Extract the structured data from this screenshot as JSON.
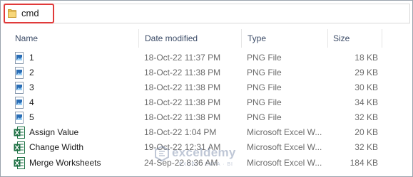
{
  "address_bar": {
    "folder_name": "cmd",
    "folder_icon": "folder-icon"
  },
  "columns": {
    "name": "Name",
    "date_modified": "Date modified",
    "type": "Type",
    "size": "Size"
  },
  "files": [
    {
      "name": "1",
      "date": "18-Oct-22 11:37 PM",
      "type": "PNG File",
      "size": "18 KB",
      "icon": "png-image-icon"
    },
    {
      "name": "2",
      "date": "18-Oct-22 11:38 PM",
      "type": "PNG File",
      "size": "29 KB",
      "icon": "png-image-icon"
    },
    {
      "name": "3",
      "date": "18-Oct-22 11:38 PM",
      "type": "PNG File",
      "size": "30 KB",
      "icon": "png-image-icon"
    },
    {
      "name": "4",
      "date": "18-Oct-22 11:38 PM",
      "type": "PNG File",
      "size": "34 KB",
      "icon": "png-image-icon"
    },
    {
      "name": "5",
      "date": "18-Oct-22 11:38 PM",
      "type": "PNG File",
      "size": "32 KB",
      "icon": "png-image-icon"
    },
    {
      "name": "Assign Value",
      "date": "18-Oct-22 1:04 PM",
      "type": "Microsoft Excel W...",
      "size": "20 KB",
      "icon": "excel-file-icon"
    },
    {
      "name": "Change Width",
      "date": "19-Oct-22 12:31 AM",
      "type": "Microsoft Excel W...",
      "size": "32 KB",
      "icon": "excel-file-icon"
    },
    {
      "name": "Merge Worksheets",
      "date": "24-Sep-22 8:36 AM",
      "type": "Microsoft Excel W...",
      "size": "184 KB",
      "icon": "excel-file-icon"
    }
  ],
  "watermark": {
    "brand": "exceldemy",
    "tagline": "EXCEL · DATA · BI"
  },
  "colors": {
    "highlight_border": "#e03a3a",
    "folder": "#f2c55c",
    "excel_green": "#1e7145",
    "png_blue": "#2a6db5"
  }
}
